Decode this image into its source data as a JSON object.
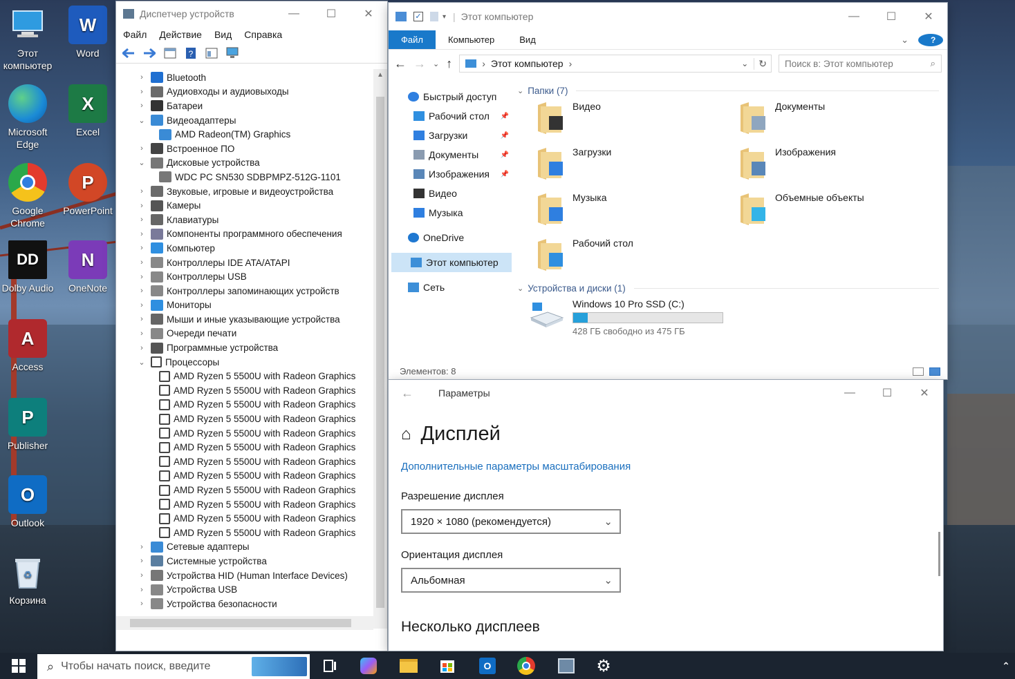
{
  "desktop": {
    "icons": [
      {
        "id": "this-pc",
        "label": "Этот компьютер"
      },
      {
        "id": "word",
        "label": "Word"
      },
      {
        "id": "edge",
        "label": "Microsoft Edge"
      },
      {
        "id": "excel",
        "label": "Excel"
      },
      {
        "id": "chrome",
        "label": "Google Chrome"
      },
      {
        "id": "powerpoint",
        "label": "PowerPoint"
      },
      {
        "id": "dolby",
        "label": "Dolby Audio"
      },
      {
        "id": "onenote",
        "label": "OneNote"
      },
      {
        "id": "access",
        "label": "Access"
      },
      {
        "id": "publisher",
        "label": "Publisher"
      },
      {
        "id": "outlook",
        "label": "Outlook"
      },
      {
        "id": "recycle",
        "label": "Корзина"
      }
    ]
  },
  "devmgr": {
    "title": "Диспетчер устройств",
    "menu": [
      "Файл",
      "Действие",
      "Вид",
      "Справка"
    ],
    "tree": [
      {
        "label": "Bluetooth",
        "level": 0,
        "state": "collapsed",
        "icon": "bluetooth-icon"
      },
      {
        "label": "Аудиовходы и аудиовыходы",
        "level": 0,
        "state": "collapsed",
        "icon": "audio-icon"
      },
      {
        "label": "Батареи",
        "level": 0,
        "state": "collapsed",
        "icon": "battery-icon"
      },
      {
        "label": "Видеоадаптеры",
        "level": 0,
        "state": "expanded",
        "icon": "display-adapter-icon"
      },
      {
        "label": "AMD Radeon(TM) Graphics",
        "level": 1,
        "state": "leaf",
        "icon": "display-adapter-icon"
      },
      {
        "label": "Встроенное ПО",
        "level": 0,
        "state": "collapsed",
        "icon": "firmware-icon"
      },
      {
        "label": "Дисковые устройства",
        "level": 0,
        "state": "expanded",
        "icon": "disk-icon"
      },
      {
        "label": "WDC PC SN530 SDBPMPZ-512G-1101",
        "level": 1,
        "state": "leaf",
        "icon": "disk-icon"
      },
      {
        "label": "Звуковые, игровые и видеоустройства",
        "level": 0,
        "state": "collapsed",
        "icon": "sound-icon"
      },
      {
        "label": "Камеры",
        "level": 0,
        "state": "collapsed",
        "icon": "camera-icon"
      },
      {
        "label": "Клавиатуры",
        "level": 0,
        "state": "collapsed",
        "icon": "keyboard-icon"
      },
      {
        "label": "Компоненты программного обеспечения",
        "level": 0,
        "state": "collapsed",
        "icon": "software-icon"
      },
      {
        "label": "Компьютер",
        "level": 0,
        "state": "collapsed",
        "icon": "computer-icon"
      },
      {
        "label": "Контроллеры IDE ATA/ATAPI",
        "level": 0,
        "state": "collapsed",
        "icon": "ide-icon"
      },
      {
        "label": "Контроллеры USB",
        "level": 0,
        "state": "collapsed",
        "icon": "usb-icon"
      },
      {
        "label": "Контроллеры запоминающих устройств",
        "level": 0,
        "state": "collapsed",
        "icon": "storage-icon"
      },
      {
        "label": "Мониторы",
        "level": 0,
        "state": "collapsed",
        "icon": "monitor-icon"
      },
      {
        "label": "Мыши и иные указывающие устройства",
        "level": 0,
        "state": "collapsed",
        "icon": "mouse-icon"
      },
      {
        "label": "Очереди печати",
        "level": 0,
        "state": "collapsed",
        "icon": "printer-icon"
      },
      {
        "label": "Программные устройства",
        "level": 0,
        "state": "collapsed",
        "icon": "software-device-icon"
      },
      {
        "label": "Процессоры",
        "level": 0,
        "state": "expanded",
        "icon": "processor-icon"
      },
      {
        "label": "AMD Ryzen 5 5500U with Radeon Graphics",
        "level": 1,
        "state": "leaf",
        "icon": "processor-icon"
      },
      {
        "label": "AMD Ryzen 5 5500U with Radeon Graphics",
        "level": 1,
        "state": "leaf",
        "icon": "processor-icon"
      },
      {
        "label": "AMD Ryzen 5 5500U with Radeon Graphics",
        "level": 1,
        "state": "leaf",
        "icon": "processor-icon"
      },
      {
        "label": "AMD Ryzen 5 5500U with Radeon Graphics",
        "level": 1,
        "state": "leaf",
        "icon": "processor-icon"
      },
      {
        "label": "AMD Ryzen 5 5500U with Radeon Graphics",
        "level": 1,
        "state": "leaf",
        "icon": "processor-icon"
      },
      {
        "label": "AMD Ryzen 5 5500U with Radeon Graphics",
        "level": 1,
        "state": "leaf",
        "icon": "processor-icon"
      },
      {
        "label": "AMD Ryzen 5 5500U with Radeon Graphics",
        "level": 1,
        "state": "leaf",
        "icon": "processor-icon"
      },
      {
        "label": "AMD Ryzen 5 5500U with Radeon Graphics",
        "level": 1,
        "state": "leaf",
        "icon": "processor-icon"
      },
      {
        "label": "AMD Ryzen 5 5500U with Radeon Graphics",
        "level": 1,
        "state": "leaf",
        "icon": "processor-icon"
      },
      {
        "label": "AMD Ryzen 5 5500U with Radeon Graphics",
        "level": 1,
        "state": "leaf",
        "icon": "processor-icon"
      },
      {
        "label": "AMD Ryzen 5 5500U with Radeon Graphics",
        "level": 1,
        "state": "leaf",
        "icon": "processor-icon"
      },
      {
        "label": "AMD Ryzen 5 5500U with Radeon Graphics",
        "level": 1,
        "state": "leaf",
        "icon": "processor-icon"
      },
      {
        "label": "Сетевые адаптеры",
        "level": 0,
        "state": "collapsed",
        "icon": "network-adapter-icon"
      },
      {
        "label": "Системные устройства",
        "level": 0,
        "state": "collapsed",
        "icon": "system-device-icon"
      },
      {
        "label": "Устройства HID (Human Interface Devices)",
        "level": 0,
        "state": "collapsed",
        "icon": "hid-icon"
      },
      {
        "label": "Устройства USB",
        "level": 0,
        "state": "collapsed",
        "icon": "usb-device-icon"
      },
      {
        "label": "Устройства безопасности",
        "level": 0,
        "state": "collapsed",
        "icon": "security-device-icon"
      }
    ]
  },
  "explorer": {
    "title": "Этот компьютер",
    "tabs": {
      "file": "Файл",
      "computer": "Компьютер",
      "view": "Вид"
    },
    "address": "Этот компьютер",
    "search_placeholder": "Поиск в: Этот компьютер",
    "nav": [
      {
        "label": "Быстрый доступ",
        "type": "top",
        "pinned": false,
        "icon": "star-icon"
      },
      {
        "label": "Рабочий стол",
        "type": "sub",
        "pinned": true,
        "icon": "desktop-folder-icon"
      },
      {
        "label": "Загрузки",
        "type": "sub",
        "pinned": true,
        "icon": "download-icon"
      },
      {
        "label": "Документы",
        "type": "sub",
        "pinned": true,
        "icon": "documents-icon"
      },
      {
        "label": "Изображения",
        "type": "sub",
        "pinned": true,
        "icon": "pictures-icon"
      },
      {
        "label": "Видео",
        "type": "sub",
        "pinned": false,
        "icon": "video-icon"
      },
      {
        "label": "Музыка",
        "type": "sub",
        "pinned": false,
        "icon": "music-icon"
      },
      {
        "label": "OneDrive",
        "type": "top-gap",
        "pinned": false,
        "icon": "onedrive-icon"
      },
      {
        "label": "Этот компьютер",
        "type": "selected",
        "pinned": false,
        "icon": "this-pc-icon"
      },
      {
        "label": "Сеть",
        "type": "top-gap",
        "pinned": false,
        "icon": "network-icon"
      }
    ],
    "folders_header": "Папки (7)",
    "folders": [
      {
        "label": "Видео",
        "icon": "video-folder-icon"
      },
      {
        "label": "Документы",
        "icon": "documents-folder-icon"
      },
      {
        "label": "Загрузки",
        "icon": "downloads-folder-icon"
      },
      {
        "label": "Изображения",
        "icon": "pictures-folder-icon"
      },
      {
        "label": "Музыка",
        "icon": "music-folder-icon"
      },
      {
        "label": "Объемные объекты",
        "icon": "3d-objects-folder-icon"
      },
      {
        "label": "Рабочий стол",
        "icon": "desktop-folder-icon"
      }
    ],
    "devices_header": "Устройства и диски (1)",
    "drive": {
      "name": "Windows 10 Pro SSD (C:)",
      "free_text": "428 ГБ свободно из 475 ГБ",
      "used_fraction": 0.099
    },
    "status": "Элементов: 8"
  },
  "settings": {
    "title": "Параметры",
    "page_title": "Дисплей",
    "scale_link": "Дополнительные параметры масштабирования",
    "resolution_label": "Разрешение дисплея",
    "resolution_value": "1920 × 1080 (рекомендуется)",
    "orientation_label": "Ориентация дисплея",
    "orientation_value": "Альбомная",
    "multi_display": "Несколько дисплеев"
  },
  "taskbar": {
    "search_placeholder": "Чтобы начать поиск, введите"
  }
}
